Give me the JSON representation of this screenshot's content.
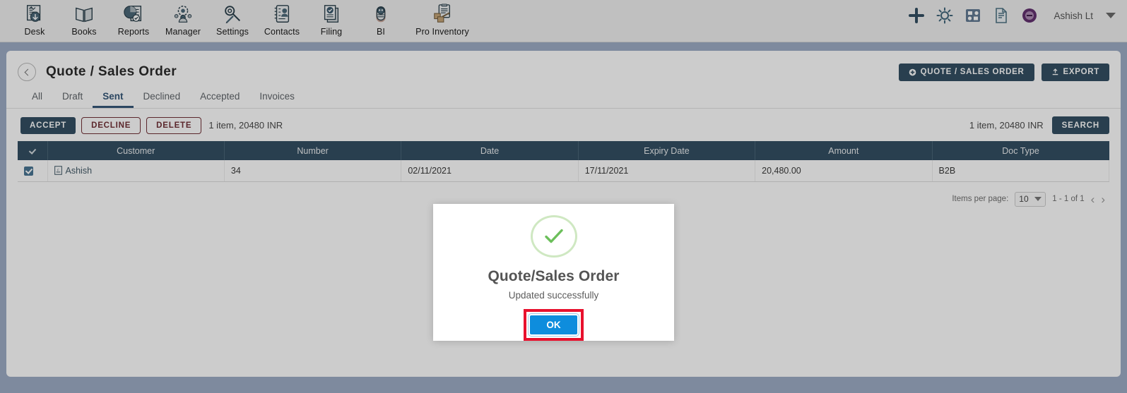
{
  "topbar": {
    "nav_items": [
      {
        "label": "Desk",
        "icon": "desk-icon"
      },
      {
        "label": "Books",
        "icon": "books-icon"
      },
      {
        "label": "Reports",
        "icon": "reports-icon"
      },
      {
        "label": "Manager",
        "icon": "manager-icon"
      },
      {
        "label": "Settings",
        "icon": "settings-icon"
      },
      {
        "label": "Contacts",
        "icon": "contacts-icon"
      },
      {
        "label": "Filing",
        "icon": "filing-icon"
      },
      {
        "label": "BI",
        "icon": "bi-icon"
      },
      {
        "label": "Pro Inventory",
        "icon": "pro-inventory-icon"
      }
    ],
    "right_icons": [
      "plus-icon",
      "gear-icon",
      "apps-grid-icon",
      "document-icon",
      "support-badge-icon"
    ],
    "user_name": "Ashish Lt"
  },
  "page": {
    "title": "Quote / Sales Order",
    "back_label": "Back",
    "primary_button": "QUOTE / SALES ORDER",
    "export_button": "EXPORT"
  },
  "tabs": [
    {
      "label": "All",
      "active": false
    },
    {
      "label": "Draft",
      "active": false
    },
    {
      "label": "Sent",
      "active": true
    },
    {
      "label": "Declined",
      "active": false
    },
    {
      "label": "Accepted",
      "active": false
    },
    {
      "label": "Invoices",
      "active": false
    }
  ],
  "actionbar": {
    "accept": "ACCEPT",
    "decline": "DECLINE",
    "delete": "DELETE",
    "summary_left": "1 item, 20480 INR",
    "summary_right": "1 item, 20480 INR",
    "search": "SEARCH"
  },
  "table": {
    "columns": [
      "Customer",
      "Number",
      "Date",
      "Expiry Date",
      "Amount",
      "Doc Type"
    ],
    "rows": [
      {
        "checked": true,
        "customer": "Ashish",
        "number": "34",
        "date": "02/11/2021",
        "expiry_date": "17/11/2021",
        "amount": "20,480.00",
        "doc_type": "B2B"
      }
    ]
  },
  "pagination": {
    "items_per_page_label": "Items per page:",
    "items_per_page_value": "10",
    "range_label": "1 - 1 of 1",
    "prev": "‹",
    "next": "›"
  },
  "modal": {
    "icon": "success-check-icon",
    "title": "Quote/Sales Order",
    "subtitle": "Updated successfully",
    "ok_label": "OK",
    "highlight_color": "#e8112d"
  },
  "colors": {
    "brand_blue": "#16557f",
    "accent_blue": "#0e8ddd",
    "danger_red": "#b0202c",
    "success_green": "#6cbf5b",
    "page_bg": "#7e8a9e"
  }
}
